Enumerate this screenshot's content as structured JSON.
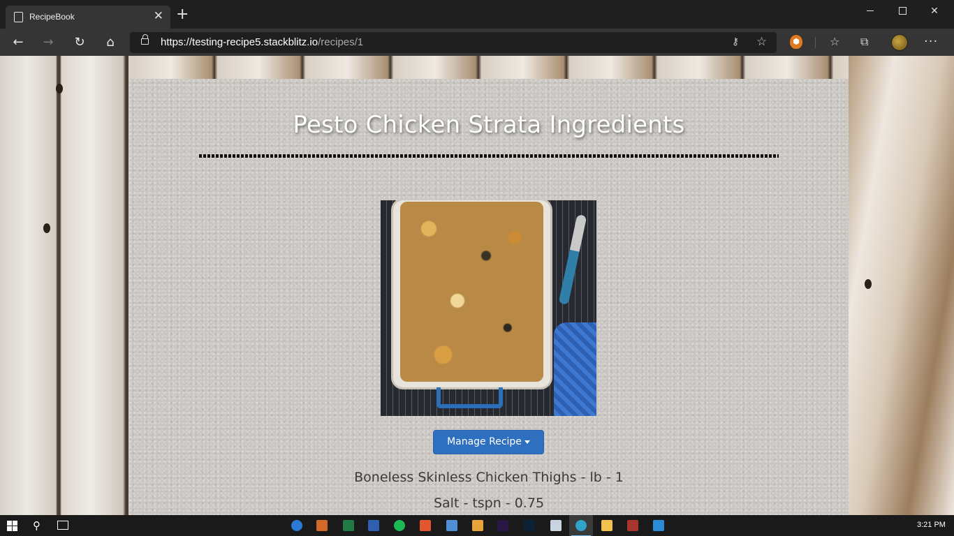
{
  "browser": {
    "tab": {
      "title": "RecipeBook",
      "close_glyph": "✕"
    },
    "new_tab_glyph": "+",
    "window_controls": {
      "close_glyph": "✕"
    },
    "nav": {
      "back_glyph": "←",
      "forward_glyph": "→",
      "refresh_glyph": "↻",
      "home_glyph": "⌂"
    },
    "address": {
      "host": "https://testing-recipe5.stackblitz.io",
      "path": "/recipes/1"
    },
    "toolbar_icons": [
      "key-icon",
      "add-favorite-icon",
      "extension-icon",
      "favorites-icon",
      "collections-icon",
      "profile-avatar",
      "menu-icon"
    ],
    "icon_glyphs": {
      "key": "⚷",
      "add_favorite": "☆",
      "favorites": "☆",
      "collections": "⧉",
      "menu": "···",
      "extension": "⬢"
    }
  },
  "page": {
    "title": "Pesto Chicken Strata Ingredients",
    "manage_button_label": "Manage Recipe",
    "ingredients": [
      "Boneless Skinless Chicken Thighs - lb - 1",
      "Salt - tspn - 0.75"
    ]
  },
  "taskbar": {
    "search_glyph": "⚲",
    "clock": "3:21 PM",
    "apps": [
      "edge-beta-icon",
      "powerpoint-icon",
      "excel-icon",
      "word-icon",
      "spotify-icon",
      "office-icon",
      "notepad-icon",
      "acrobat-icon",
      "premiere-icon",
      "photoshop-icon",
      "paint-icon",
      "edge-icon",
      "file-explorer-icon",
      "winrar-icon",
      "vscode-icon"
    ],
    "colors": {
      "edge-beta-icon": "#2b7bd6",
      "powerpoint-icon": "#d0692a",
      "excel-icon": "#1f7a45",
      "word-icon": "#2f5fb3",
      "spotify-icon": "#1db954",
      "office-icon": "#e4572e",
      "notepad-icon": "#4f8fd8",
      "acrobat-icon": "#e8a43a",
      "premiere-icon": "#2a1746",
      "photoshop-icon": "#0d2136",
      "paint-icon": "#c8d4e0",
      "edge-icon": "#2fa3c9",
      "file-explorer-icon": "#f2c14e",
      "winrar-icon": "#a8342e",
      "vscode-icon": "#2a8bd7"
    }
  },
  "colors": {
    "accent_button": "#2f6fbf",
    "title_text": "#ffffff",
    "ingredient_text": "#3b3b3b"
  }
}
